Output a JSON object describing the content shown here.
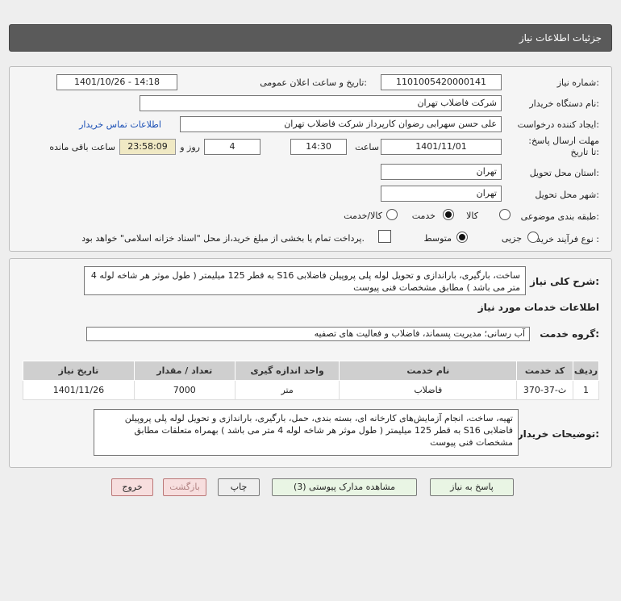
{
  "page": {
    "title": "جزئیات اطلاعات نیاز"
  },
  "need": {
    "number_label": "شماره نیاز:",
    "number": "1101005420000141",
    "announce_label": "تاریخ و ساعت اعلان عمومی:",
    "announce_value": "1401/10/26 - 14:18",
    "buyer_label": "نام دستگاه خریدار:",
    "buyer": "شرکت فاضلاب تهران",
    "creator_label": "ایجاد کننده درخواست:",
    "creator": "علی حسن  سهرابی رضوان کارپرداز شرکت فاضلاب تهران",
    "contact_link": "اطلاعات تماس خریدار",
    "deadline_label": "مهلت ارسال پاسخ: تا تاریخ:",
    "deadline_date": "1401/11/01",
    "time_label": "ساعت",
    "deadline_time": "14:30",
    "days_value": "4",
    "days_label": "روز و",
    "remaining_time": "23:58:09",
    "remaining_label": "ساعت باقی مانده",
    "province_label": "استان محل تحویل:",
    "province": "تهران",
    "city_label": "شهر محل تحویل:",
    "city": "تهران",
    "category_label": "طبقه بندی موضوعی:",
    "category_options": [
      "کالا",
      "خدمت",
      "کالا/خدمت"
    ],
    "category_selected": "خدمت",
    "process_label": "نوع فرآیند خرید :",
    "process_options": [
      "جزیی",
      "متوسط"
    ],
    "process_selected": "متوسط",
    "payment_note": "پرداخت تمام یا بخشی از مبلغ خرید،از محل \"اسناد خزانه اسلامی\" خواهد بود."
  },
  "summary": {
    "label": "شرح کلی نیاز:",
    "text": "ساخت، بارگیری، باراندازی و تحویل لوله پلی پروپیلن فاضلابی S16 به قطر 125 میلیمتر ( طول موثر هر شاخه لوله 4 متر می باشد ) مطابق مشخصات فنی پیوست"
  },
  "services": {
    "section_title": "اطلاعات خدمات مورد نیاز",
    "group_label": "گروه خدمت:",
    "group_value": "آب رسانی؛ مدیریت پسماند، فاضلاب و فعالیت های تصفیه",
    "columns": [
      "ردیف",
      "کد خدمت",
      "نام خدمت",
      "واحد اندازه گیری",
      "تعداد / مقدار",
      "تاریخ نیاز"
    ],
    "rows": [
      [
        "1",
        "ث-37-370",
        "فاضلاب",
        "متر",
        "7000",
        "1401/11/26"
      ]
    ]
  },
  "buyer_notes": {
    "label": "توضیحات خریدار:",
    "text": "تهیه، ساخت، انجام آزمایش‌های کارخانه ای، بسته بندی، حمل، بارگیری، باراندازی و تحویل لوله پلی پروپیلن فاضلابی S16 به قطر 125 میلیمتر ( طول موثر هر شاخه لوله 4 متر می باشد ) بهمراه متعلقات مطابق مشخصات فنی پیوست"
  },
  "buttons": {
    "reply": "پاسخ به نیاز",
    "view_docs": "مشاهده مدارک پیوستی (3)",
    "print": "چاپ",
    "back": "بازگشت",
    "exit": "خروج"
  }
}
